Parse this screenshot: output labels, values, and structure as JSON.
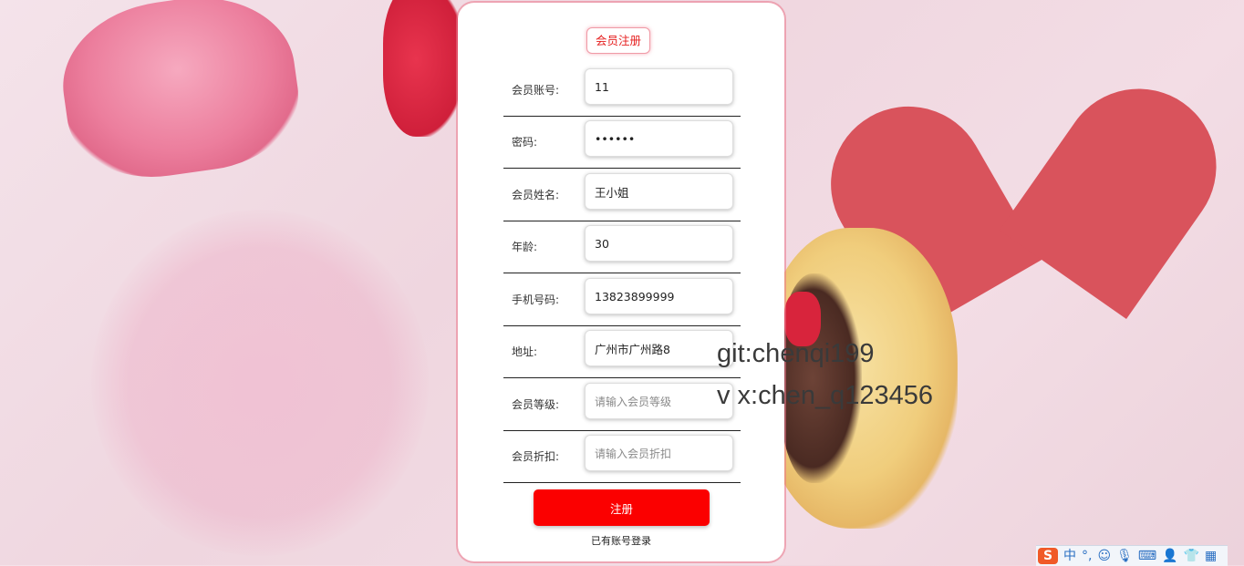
{
  "form": {
    "title": "会员注册",
    "fields": [
      {
        "label": "会员账号:",
        "value": "11",
        "placeholder": ""
      },
      {
        "label": "密码:",
        "value": "••••••",
        "placeholder": ""
      },
      {
        "label": "会员姓名:",
        "value": "王小姐",
        "placeholder": ""
      },
      {
        "label": "年龄:",
        "value": "30",
        "placeholder": ""
      },
      {
        "label": "手机号码:",
        "value": "13823899999",
        "placeholder": ""
      },
      {
        "label": "地址:",
        "value": "广州市广州路8",
        "placeholder": ""
      },
      {
        "label": "会员等级:",
        "value": "",
        "placeholder": "请输入会员等级"
      },
      {
        "label": "会员折扣:",
        "value": "",
        "placeholder": "请输入会员折扣"
      }
    ],
    "submit_label": "注册",
    "login_link": "已有账号登录"
  },
  "watermark": {
    "line1": "git:chenqi199",
    "line2": "v x:chen_q123456"
  },
  "ime_toolbar": {
    "logo": "S",
    "mode": "中",
    "punct": "°,",
    "icons": [
      "smiley-icon",
      "microphone-icon",
      "keyboard-icon",
      "user-icon",
      "shirt-icon",
      "grid-icon"
    ]
  },
  "colors": {
    "accent": "#fb0000",
    "title_text": "#e52020"
  }
}
